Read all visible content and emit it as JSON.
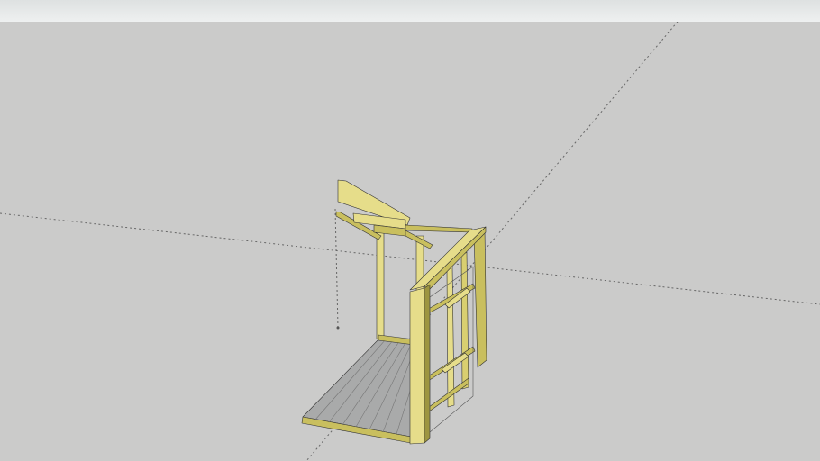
{
  "colors": {
    "background": "#cbcbca",
    "toolbar": "#e6e8e8",
    "wood_light": "#e6dd8a",
    "wood_mid": "#c9bf5e",
    "wood_dark": "#9d9540",
    "deck": "#a9aaaa",
    "axis": "#555555"
  },
  "icons": {
    "model": "3d-model-frame"
  }
}
